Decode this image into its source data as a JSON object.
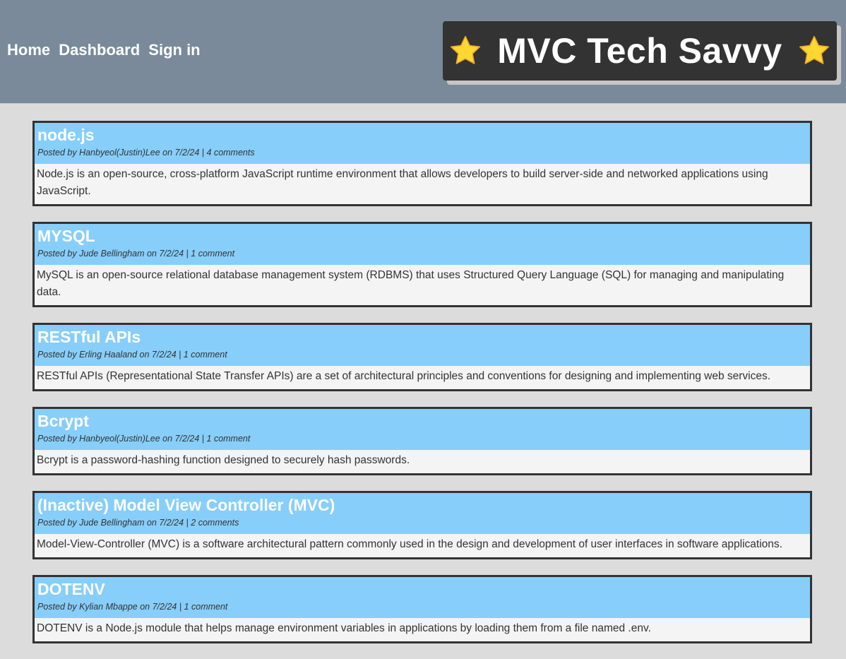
{
  "nav": {
    "home": "Home",
    "dashboard": "Dashboard",
    "signin": "Sign in"
  },
  "brand": {
    "title": "MVC Tech Savvy",
    "icon": "star-icon",
    "icon_color": "#FDD835"
  },
  "colors": {
    "header_bg": "#7a8a9a",
    "page_bg": "#dcdcdc",
    "post_header_bg": "#87cefa",
    "brand_bg": "#333333"
  },
  "posts": [
    {
      "title": "node.js",
      "meta_prefix": "Posted by Hanbyeol(Justin)Lee on 7/2/24 | ",
      "comments": "4 comments",
      "body": "Node.js is an open-source, cross-platform JavaScript runtime environment that allows developers to build server-side and networked applications using JavaScript."
    },
    {
      "title": "MYSQL",
      "meta_prefix": "Posted by Jude Bellingham on 7/2/24 | ",
      "comments": "1 comment",
      "body": "MySQL is an open-source relational database management system (RDBMS) that uses Structured Query Language (SQL) for managing and manipulating data."
    },
    {
      "title": "RESTful APIs",
      "meta_prefix": "Posted by Erling Haaland on 7/2/24 | ",
      "comments": "1 comment",
      "body": "RESTful APIs (Representational State Transfer APIs) are a set of architectural principles and conventions for designing and implementing web services."
    },
    {
      "title": "Bcrypt",
      "meta_prefix": "Posted by Hanbyeol(Justin)Lee on 7/2/24 | ",
      "comments": "1 comment",
      "body": "Bcrypt is a password-hashing function designed to securely hash passwords."
    },
    {
      "title": "(Inactive) Model View Controller (MVC)",
      "meta_prefix": "Posted by Jude Bellingham on 7/2/24 | ",
      "comments": "2 comments",
      "body": "Model-View-Controller (MVC) is a software architectural pattern commonly used in the design and development of user interfaces in software applications."
    },
    {
      "title": "DOTENV",
      "meta_prefix": "Posted by Kylian Mbappe on 7/2/24 | ",
      "comments": "1 comment",
      "body": "DOTENV is a Node.js module that helps manage environment variables in applications by loading them from a file named .env."
    }
  ]
}
